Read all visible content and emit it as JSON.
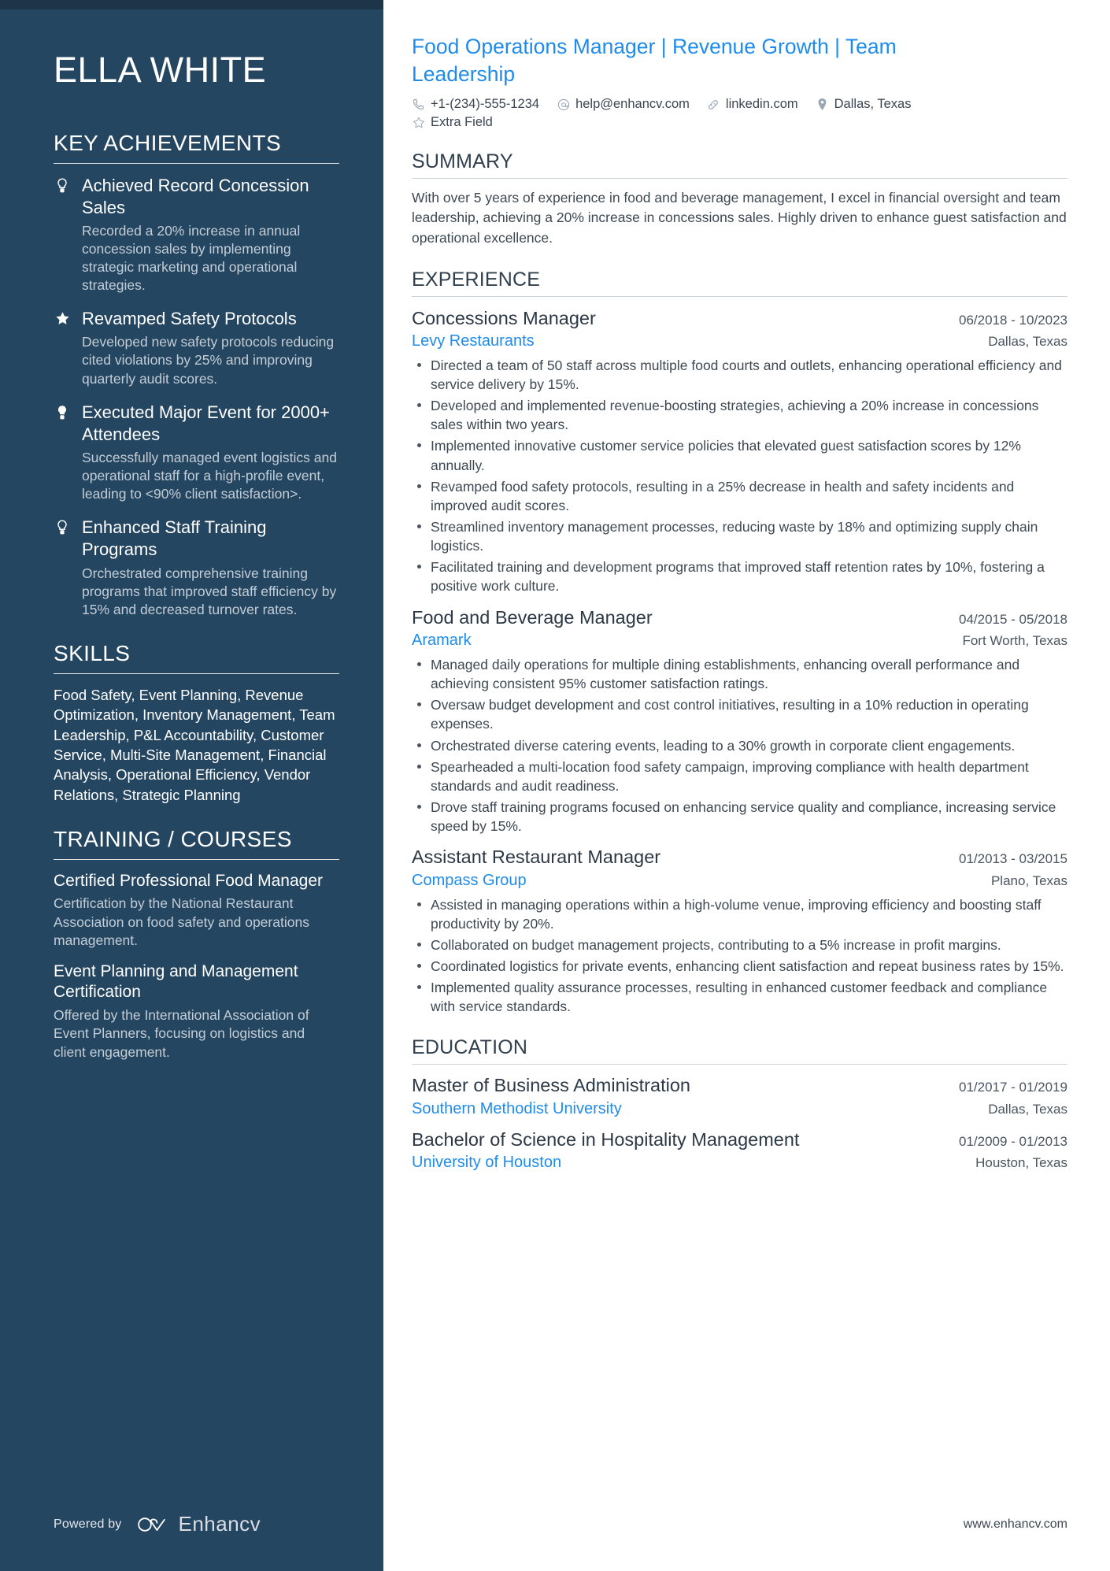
{
  "sidebar": {
    "name": "ELLA WHITE",
    "achievements_heading": "KEY ACHIEVEMENTS",
    "achievements": [
      {
        "icon": "lightbulb-icon",
        "title": "Achieved Record Concession Sales",
        "desc": "Recorded a 20% increase in annual concession sales by implementing strategic marketing and operational strategies."
      },
      {
        "icon": "star-icon",
        "title": "Revamped Safety Protocols",
        "desc": "Developed new safety protocols reducing cited violations by 25% and improving quarterly audit scores."
      },
      {
        "icon": "lightbulb-filled-icon",
        "title": "Executed Major Event for 2000+ Attendees",
        "desc": "Successfully managed event logistics and operational staff for a high-profile event, leading to <90% client satisfaction>."
      },
      {
        "icon": "lightbulb-icon",
        "title": "Enhanced Staff Training Programs",
        "desc": "Orchestrated comprehensive training programs that improved staff efficiency by 15% and decreased turnover rates."
      }
    ],
    "skills_heading": "SKILLS",
    "skills_text": "Food Safety, Event Planning, Revenue Optimization, Inventory Management, Team Leadership, P&L Accountability, Customer Service, Multi-Site Management, Financial Analysis, Operational Efficiency, Vendor Relations, Strategic Planning",
    "training_heading": "TRAINING / COURSES",
    "courses": [
      {
        "title": "Certified Professional Food Manager",
        "desc": "Certification by the National Restaurant Association on food safety and operations management."
      },
      {
        "title": "Event Planning and Management Certification",
        "desc": "Offered by the International Association of Event Planners, focusing on logistics and client engagement."
      }
    ],
    "footer": {
      "powered_by": "Powered by",
      "brand": "Enhancv"
    }
  },
  "main": {
    "headline": "Food Operations Manager | Revenue Growth | Team Leadership",
    "contacts": [
      {
        "icon": "phone-icon",
        "text": "+1-(234)-555-1234"
      },
      {
        "icon": "at-email-icon",
        "text": "help@enhancv.com"
      },
      {
        "icon": "link-icon",
        "text": "linkedin.com"
      },
      {
        "icon": "location-pin-icon",
        "text": "Dallas, Texas"
      },
      {
        "icon": "star-outline-icon",
        "text": "Extra Field"
      }
    ],
    "summary_heading": "SUMMARY",
    "summary_text": "With over 5 years of experience in food and beverage management, I excel in financial oversight and team leadership, achieving a 20% increase in concessions sales. Highly driven to enhance guest satisfaction and operational excellence.",
    "experience_heading": "EXPERIENCE",
    "experience": [
      {
        "title": "Concessions Manager",
        "date": "06/2018 - 10/2023",
        "org": "Levy Restaurants",
        "location": "Dallas, Texas",
        "bullets": [
          "Directed a team of 50 staff across multiple food courts and outlets, enhancing operational efficiency and service delivery by 15%.",
          "Developed and implemented revenue-boosting strategies, achieving a 20% increase in concessions sales within two years.",
          "Implemented innovative customer service policies that elevated guest satisfaction scores by 12% annually.",
          "Revamped food safety protocols, resulting in a 25% decrease in health and safety incidents and improved audit scores.",
          "Streamlined inventory management processes, reducing waste by 18% and optimizing supply chain logistics.",
          "Facilitated training and development programs that improved staff retention rates by 10%, fostering a positive work culture."
        ]
      },
      {
        "title": "Food and Beverage Manager",
        "date": "04/2015 - 05/2018",
        "org": "Aramark",
        "location": "Fort Worth, Texas",
        "bullets": [
          "Managed daily operations for multiple dining establishments, enhancing overall performance and achieving consistent 95% customer satisfaction ratings.",
          "Oversaw budget development and cost control initiatives, resulting in a 10% reduction in operating expenses.",
          "Orchestrated diverse catering events, leading to a 30% growth in corporate client engagements.",
          "Spearheaded a multi-location food safety campaign, improving compliance with health department standards and audit readiness.",
          "Drove staff training programs focused on enhancing service quality and compliance, increasing service speed by 15%."
        ]
      },
      {
        "title": "Assistant Restaurant Manager",
        "date": "01/2013 - 03/2015",
        "org": "Compass Group",
        "location": "Plano, Texas",
        "bullets": [
          "Assisted in managing operations within a high-volume venue, improving efficiency and boosting staff productivity by 20%.",
          "Collaborated on budget management projects, contributing to a 5% increase in profit margins.",
          "Coordinated logistics for private events, enhancing client satisfaction and repeat business rates by 15%.",
          "Implemented quality assurance processes, resulting in enhanced customer feedback and compliance with service standards."
        ]
      }
    ],
    "education_heading": "EDUCATION",
    "education": [
      {
        "degree": "Master of Business Administration",
        "date": "01/2017 - 01/2019",
        "school": "Southern Methodist University",
        "location": "Dallas, Texas"
      },
      {
        "degree": "Bachelor of Science in Hospitality Management",
        "date": "01/2009 - 01/2013",
        "school": "University of Houston",
        "location": "Houston, Texas"
      }
    ],
    "footer_url": "www.enhancv.com"
  },
  "colors": {
    "sidebar_bg": "#254661",
    "accent_blue": "#1f8ceb",
    "body_text": "#3d4852"
  }
}
